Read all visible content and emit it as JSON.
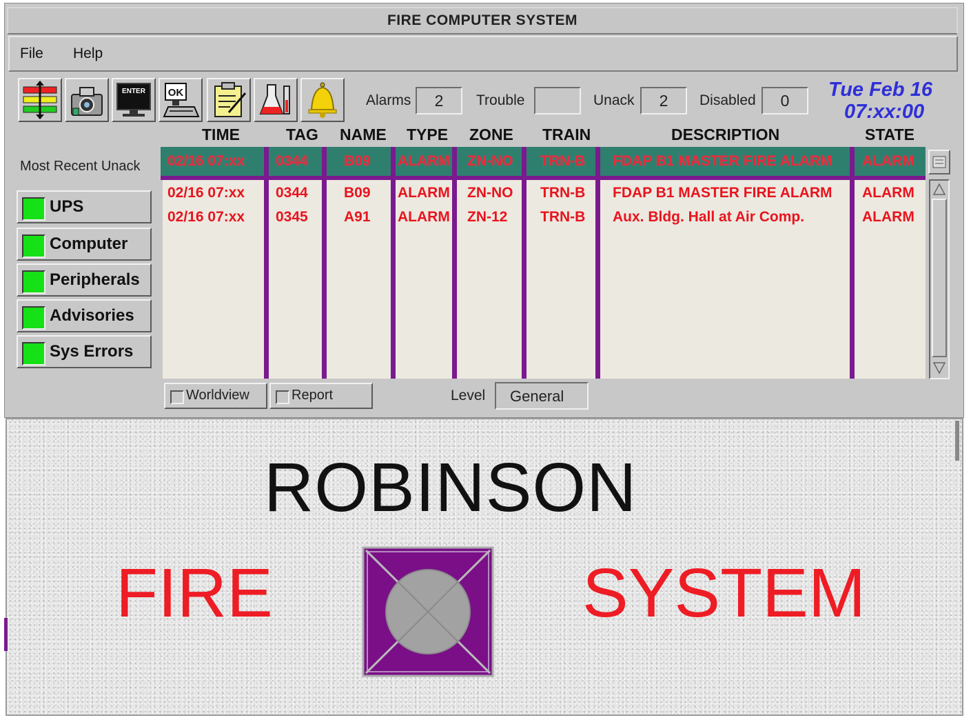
{
  "window": {
    "title": "FIRE COMPUTER SYSTEM"
  },
  "menu": {
    "file": "File",
    "help": "Help"
  },
  "toolbar": {
    "icons": [
      "layers-icon",
      "camera-icon",
      "enter-terminal-icon",
      "ok-computer-icon",
      "notepad-icon",
      "lab-flask-icon",
      "bell-icon"
    ],
    "enter_caption": "ENTER",
    "ok_caption": "OK"
  },
  "counters": {
    "alarms_label": "Alarms",
    "alarms_value": "2",
    "trouble_label": "Trouble",
    "trouble_value": "",
    "unack_label": "Unack",
    "unack_value": "2",
    "disabled_label": "Disabled",
    "disabled_value": "0"
  },
  "clock": {
    "date": "Tue Feb 16",
    "time": "07:xx:00"
  },
  "table": {
    "columns": [
      "TIME",
      "TAG",
      "NAME",
      "TYPE",
      "ZONE",
      "TRAIN",
      "DESCRIPTION",
      "STATE"
    ],
    "most_recent_label": "Most Recent Unack",
    "most_recent": [
      "02/16  07:xx",
      "0344",
      "B09",
      "ALARM",
      "ZN-NO",
      "TRN-B",
      "FDAP B1 MASTER FIRE ALARM",
      "ALARM"
    ],
    "rows": [
      [
        "02/16  07:xx",
        "0344",
        "B09",
        "ALARM",
        "ZN-NO",
        "TRN-B",
        "FDAP B1 MASTER FIRE ALARM",
        "ALARM"
      ],
      [
        "02/16  07:xx",
        "0345",
        "A91",
        "ALARM",
        "ZN-12",
        "TRN-B",
        "Aux. Bldg. Hall at Air Comp.",
        "ALARM"
      ]
    ]
  },
  "status_buttons": [
    "UPS",
    "Computer",
    "Peripherals",
    "Advisories",
    "Sys Errors"
  ],
  "bottom": {
    "worldview": "Worldview",
    "report": "Report",
    "level_label": "Level",
    "level_value": "General"
  },
  "banner": {
    "title": "ROBINSON",
    "left_word": "FIRE",
    "right_word": "SYSTEM"
  },
  "colors": {
    "alarm_text": "#e8141e",
    "recent_row_bg": "#2f7f6f",
    "column_divider": "#7a1a8e",
    "status_ok": "#16e016",
    "clock_text": "#2f2fd8"
  }
}
